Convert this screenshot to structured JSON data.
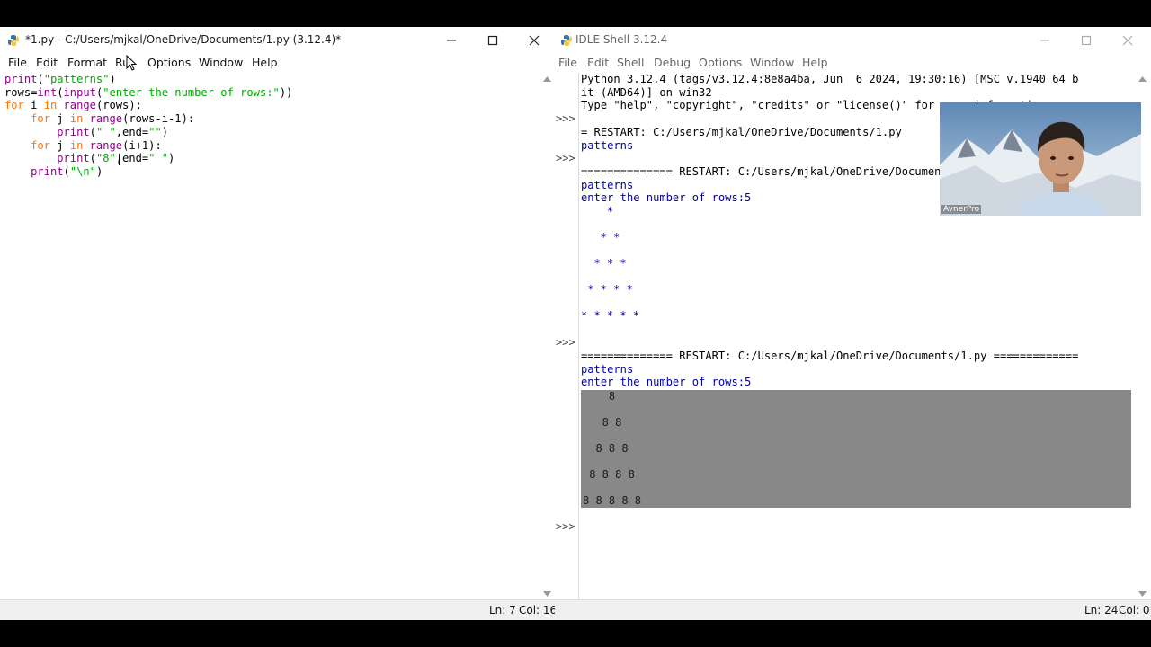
{
  "editor": {
    "title": "*1.py - C:/Users/mjkal/OneDrive/Documents/1.py (3.12.4)*",
    "menu": [
      "File",
      "Edit",
      "Format",
      "Run",
      "Options",
      "Window",
      "Help"
    ],
    "status": {
      "line": "Ln: 7",
      "col": "Col: 16"
    }
  },
  "shell": {
    "title": "IDLE Shell 3.12.4",
    "menu": [
      "File",
      "Edit",
      "Shell",
      "Debug",
      "Options",
      "Window",
      "Help"
    ],
    "status": {
      "line": "Ln: 24",
      "col": "Col: 0"
    },
    "header": [
      "Python 3.12.4 (tags/v3.12.4:8e8a4ba, Jun  6 2024, 19:30:16) [MSC v.1940 64 b",
      "it (AMD64)] on win32",
      "Type \"help\", \"copyright\", \"credits\" or \"license()\" for more information."
    ],
    "prompt": ">>>",
    "restart1": "= RESTART: C:/Users/mjkal/OneDrive/Documents/1.py",
    "restart2": "============== RESTART: C:/Users/mjkal/OneDrive/Documents/1.py ==============",
    "restart3": "============== RESTART: C:/Users/mjkal/OneDrive/Documents/1.py =============",
    "patterns": "patterns",
    "enter_rows": "enter the number of rows:5",
    "star_rows": [
      "    *",
      "   * *",
      "  * * *",
      " * * * *",
      "* * * * *"
    ],
    "eight_rows": [
      "    8",
      "   8 8",
      "  8 8 8",
      " 8 8 8 8",
      "8 8 8 8 8"
    ]
  },
  "webcam": {
    "label": "AvnerPro"
  },
  "colors": {
    "keyword": "#ff7700",
    "string": "#00aa00",
    "builtin": "#900090",
    "output": "#0000aa",
    "selection": "#888888"
  }
}
